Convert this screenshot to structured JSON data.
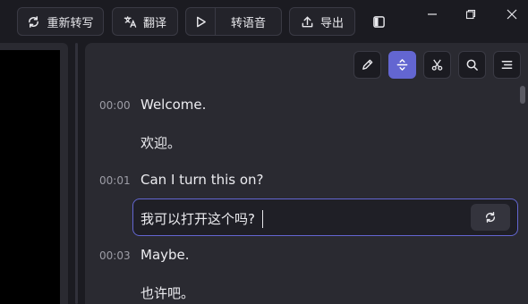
{
  "toolbar": {
    "retranscribe_label": "重新转写",
    "translate_label": "翻译",
    "to_speech_label": "转语音",
    "export_label": "导出"
  },
  "transcript": {
    "segments": [
      {
        "time": "00:00",
        "original": "Welcome.",
        "translation": "欢迎。"
      },
      {
        "time": "00:01",
        "original": "Can I turn this on?",
        "translation": "我可以打开这个吗?"
      },
      {
        "time": "00:03",
        "original": "Maybe.",
        "translation": "也许吧。"
      }
    ],
    "editing_segment_index": 1
  },
  "colors": {
    "accent": "#6366d1",
    "panel_bg": "#2a2a31",
    "app_bg": "#1b1b21"
  },
  "icons": {
    "retranscribe": "refresh-icon",
    "translate": "translate-icon",
    "play": "play-icon",
    "export": "upload-icon",
    "sidebar_toggle": "sidebar-toggle-icon",
    "edit": "pencil-icon",
    "align": "expand-vertical-icon",
    "cut": "scissors-icon",
    "search": "search-icon",
    "menu": "menu-icon"
  }
}
